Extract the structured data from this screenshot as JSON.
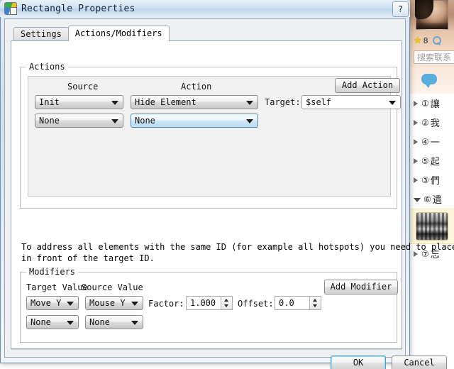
{
  "window": {
    "title": "Rectangle Properties",
    "icon": "app-globe-page-icon",
    "help_label": "?"
  },
  "tabs": [
    {
      "label": "Settings",
      "active": false
    },
    {
      "label": "Actions/Modifiers",
      "active": true
    }
  ],
  "actions_group": {
    "legend": "Actions",
    "columns": {
      "source": "Source",
      "action": "Action"
    },
    "add_button": "Add Action",
    "target_label": "Target:",
    "target_value": "$self",
    "rows": [
      {
        "source": "Init",
        "action": "Hide Element",
        "action_hot": false
      },
      {
        "source": "None",
        "action": "None",
        "action_hot": true
      }
    ]
  },
  "hint": {
    "line1": "To address all elements with the same ID (for example all hotspots) you need to place a '%'",
    "line2": "in front of the target ID."
  },
  "modifiers_group": {
    "legend": "Modifiers",
    "columns": {
      "target_value": "Target Value",
      "source_value": "Source Value"
    },
    "add_button": "Add Modifier",
    "factor_label": "Factor:",
    "factor_value": "1.000",
    "offset_label": "Offset:",
    "offset_value": "0.0",
    "rows": [
      {
        "target": "Move Y",
        "source": "Mouse Y"
      },
      {
        "target": "None",
        "source": "None"
      }
    ]
  },
  "footer": {
    "ok": "OK",
    "cancel": "Cancel"
  },
  "sidebar": {
    "star_count": "8",
    "search_placeholder": "搜索联系",
    "groups": [
      {
        "num": "①",
        "name": "讓",
        "open": false
      },
      {
        "num": "②",
        "name": "我",
        "open": false
      },
      {
        "num": "④",
        "name": "一",
        "open": false
      },
      {
        "num": "⑤",
        "name": "起",
        "open": false
      },
      {
        "num": "③",
        "name": "們",
        "open": false
      },
      {
        "num": "⑥",
        "name": "遺",
        "open": true
      },
      {
        "num": "⑦",
        "name": "忘",
        "open": false
      }
    ]
  },
  "colors": {
    "accent": "#3c9fd6",
    "title_text": "#13233a",
    "dialog_bg": "#eef0f2",
    "panel_bg": "#f1f1f1",
    "hot_combo": "#b9dcf2"
  }
}
